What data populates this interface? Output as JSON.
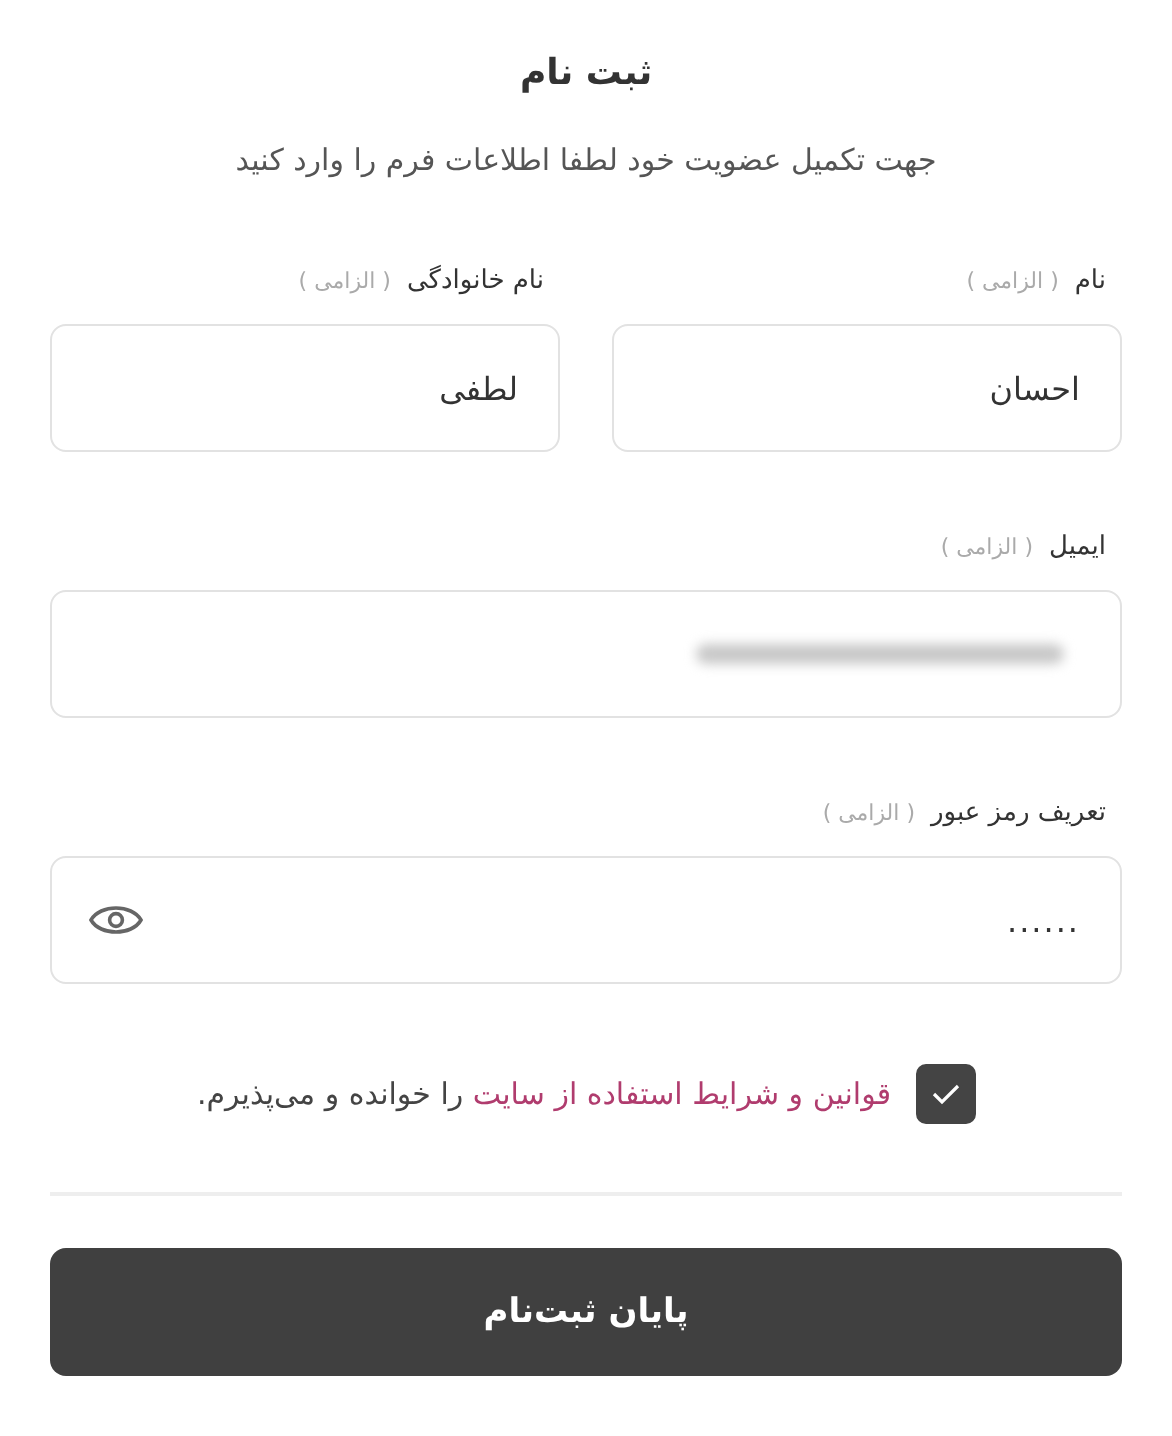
{
  "title": "ثبت نام",
  "subtitle": "جهت تکمیل عضویت خود لطفا اطلاعات فرم را وارد کنید",
  "rows": [
    {
      "fields": [
        {
          "label": "نام",
          "hint": "( الزامی )",
          "value": "احسان",
          "kind": "text"
        },
        {
          "label": "نام خانوادگی",
          "hint": "( الزامی )",
          "value": "لطفی",
          "kind": "text"
        }
      ]
    },
    {
      "fields": [
        {
          "label": "ایمیل",
          "hint": "( الزامی )",
          "kind": "redacted"
        }
      ]
    },
    {
      "fields": [
        {
          "label": "تعریف رمز عبور",
          "hint": "( الزامی )",
          "value": "......",
          "kind": "password"
        }
      ]
    }
  ],
  "terms": {
    "checked": true,
    "link": "قوانین و شرایط استفاده از سایت",
    "text": " را خوانده و می‌پذیرم."
  },
  "submit": "پایان ثبت‌نام"
}
